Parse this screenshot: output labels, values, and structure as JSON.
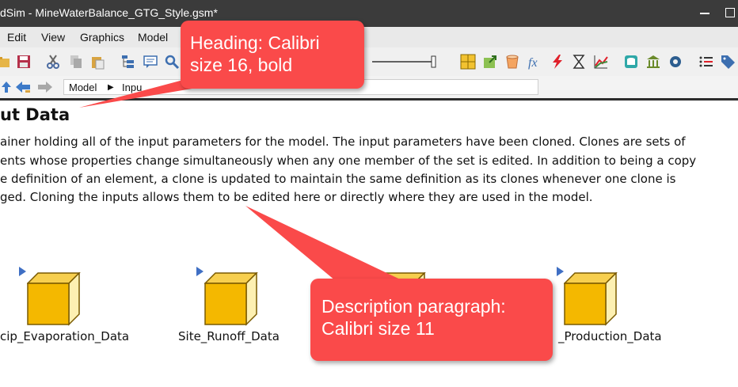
{
  "window": {
    "title": "dSim  -  MineWaterBalance_GTG_Style.gsm*"
  },
  "menu": {
    "items": [
      "Edit",
      "View",
      "Graphics",
      "Model"
    ]
  },
  "toolbar": {
    "icons": [
      "open-icon",
      "save-icon",
      "cut-icon",
      "copy-icon",
      "paste-icon",
      "browser-icon",
      "comment-icon",
      "find-icon",
      "zoom-slider",
      "grid-icon",
      "export-icon",
      "container-icon",
      "function-icon",
      "event-icon",
      "timer-icon",
      "chart-icon",
      "database-icon",
      "institution-icon",
      "settings-icon",
      "list-icon",
      "tag-icon"
    ]
  },
  "breadcrumb": {
    "item1": "Model",
    "item2": "Inpu"
  },
  "content": {
    "heading": "ut Data",
    "paragraph": [
      "ainer holding all of the input parameters for the model. The input parameters have been cloned. Clones are sets of",
      "ents whose properties change simultaneously when any one member of the set is edited. In addition to being a copy",
      "e definition of an element, a clone is updated to maintain the same definition as its clones whenever one clone is",
      "ged. Cloning the inputs allows them to be edited here or directly where they are used in the model."
    ]
  },
  "elements": [
    {
      "label": "cip_Evaporation_Data"
    },
    {
      "label": "Site_Runoff_Data"
    },
    {
      "label": ""
    },
    {
      "label": "_Production_Data"
    }
  ],
  "callouts": {
    "heading": [
      "Heading: Calibri",
      "size 16, bold"
    ],
    "description": [
      "Description paragraph:",
      "Calibri size 11"
    ],
    "color": "#fa4a4a"
  }
}
